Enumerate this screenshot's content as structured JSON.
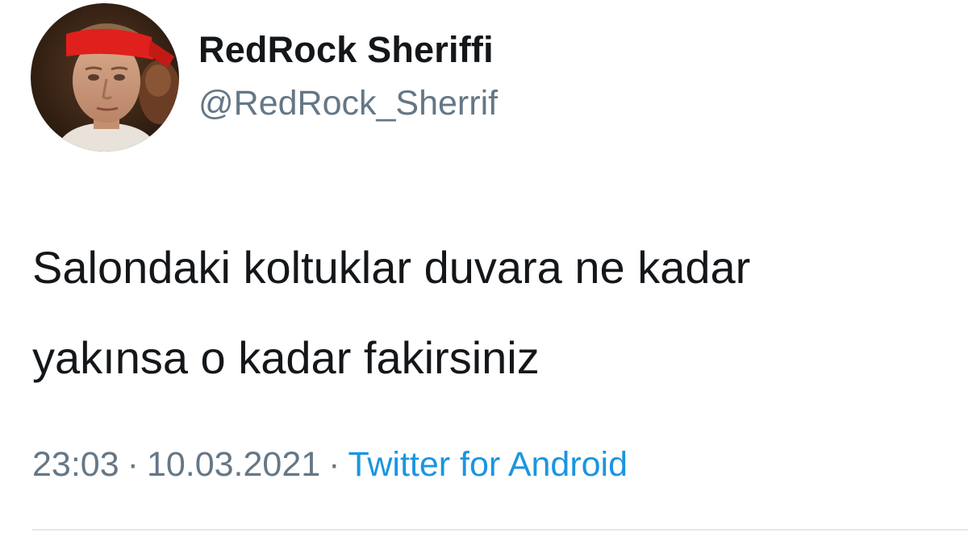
{
  "tweet": {
    "author": {
      "display_name": "RedRock Sheriffi",
      "handle": "@RedRock_Sherrif",
      "avatar_icon": "profile-photo-red-headband"
    },
    "text_lines": [
      "Salondaki koltuklar duvara ne kadar",
      "yakınsa o kadar fakirsiniz"
    ],
    "time": "23:03",
    "separator": "·",
    "date": "10.03.2021",
    "source": "Twitter for Android"
  },
  "colors": {
    "primary_text": "#14171a",
    "secondary_text": "#657786",
    "link": "#1b95e0",
    "divider": "#e1e8ed",
    "headband": "#e0201c"
  }
}
